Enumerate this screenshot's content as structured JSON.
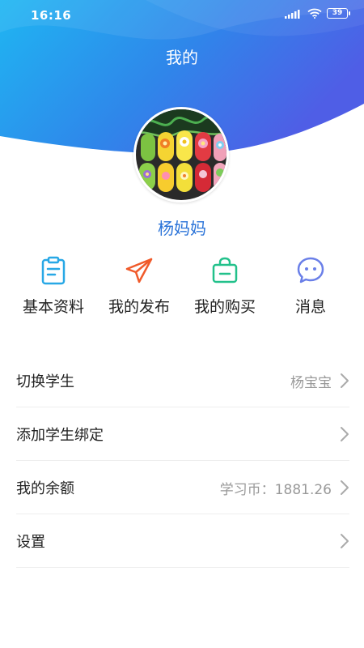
{
  "status_bar": {
    "time": "16:16",
    "battery": "39"
  },
  "header": {
    "title": "我的"
  },
  "profile": {
    "name": "杨妈妈"
  },
  "quick_actions": [
    {
      "label": "基本资料",
      "icon": "clipboard-icon",
      "color": "#28a8e6"
    },
    {
      "label": "我的发布",
      "icon": "paper-plane-icon",
      "color": "#f05a2a"
    },
    {
      "label": "我的购买",
      "icon": "shopping-bag-icon",
      "color": "#22c18b"
    },
    {
      "label": "消息",
      "icon": "chat-bubble-icon",
      "color": "#6a7fe8"
    }
  ],
  "menu": [
    {
      "label": "切换学生",
      "value": "杨宝宝"
    },
    {
      "label": "添加学生绑定",
      "value": ""
    },
    {
      "label": "我的余额",
      "value": "学习币：1881.26"
    },
    {
      "label": "设置",
      "value": ""
    }
  ],
  "colors": {
    "header_start": "#1fb6f2",
    "header_end": "#4a63e6",
    "accent_text": "#2a73d8"
  }
}
